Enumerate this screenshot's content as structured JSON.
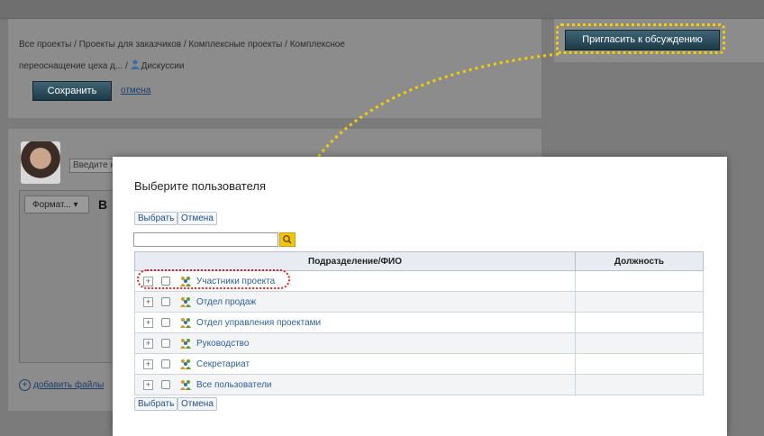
{
  "breadcrumb": {
    "line1": "Все проекты / Проекты для заказчиков / Комплексные проекты / Комплексное",
    "line2": "переоснащение цеха д...",
    "current": "Дискуссии"
  },
  "header": {
    "save_label": "Сохранить",
    "cancel_label": "отмена",
    "invite_label": "Пригласить к обсуждению"
  },
  "composer": {
    "input_value": "Введите н",
    "format_label": "Формат...",
    "bold_label": "B",
    "add_files_label": "добавить файлы"
  },
  "modal": {
    "title": "Выберите пользователя",
    "select_label": "Выбрать",
    "cancel_label": "Отмена",
    "search_value": "",
    "columns": [
      "Подразделение/ФИО",
      "Должность"
    ],
    "rows": [
      {
        "label": "Участники проекта",
        "position": ""
      },
      {
        "label": "Отдел продаж",
        "position": ""
      },
      {
        "label": "Отдел управления проектами",
        "position": ""
      },
      {
        "label": "Руководство",
        "position": ""
      },
      {
        "label": "Секретариат",
        "position": ""
      },
      {
        "label": "Все пользователи",
        "position": ""
      }
    ]
  },
  "colors": {
    "highlight_yellow": "#f2d000",
    "highlight_red": "#dd2222",
    "accent_button": "#2b4d5c"
  }
}
